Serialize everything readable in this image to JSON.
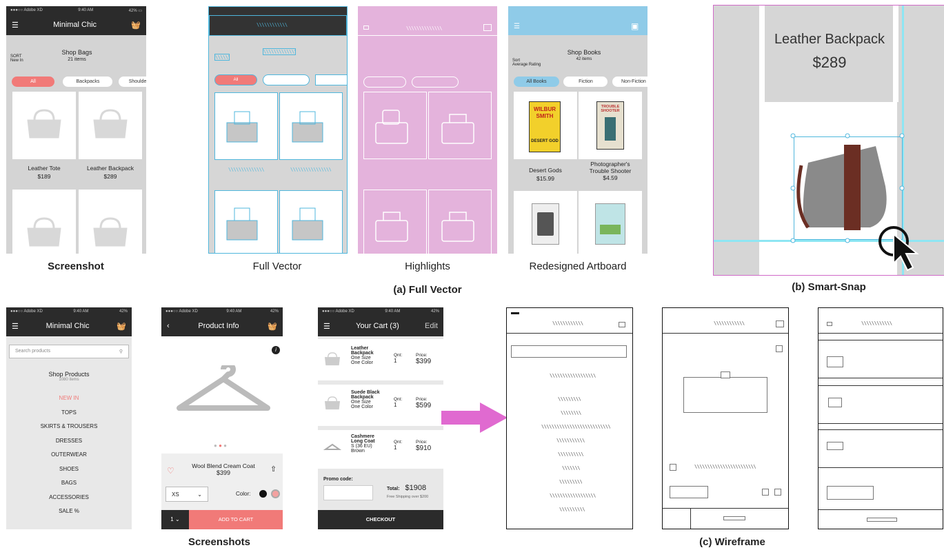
{
  "status": {
    "carrier": "●●●○○ Adobe XD",
    "time": "9:40 AM",
    "battery": "42%"
  },
  "screenshot1": {
    "title": "Minimal Chic",
    "sort_label": "SORT",
    "sort_value": "New In",
    "heading": "Shop Bags",
    "count": "21 items",
    "chips": [
      "All",
      "Backpacks",
      "Shoulder Bag"
    ],
    "products": [
      {
        "name": "Leather Tote",
        "price": "$189"
      },
      {
        "name": "Leather Backpack",
        "price": "$289"
      }
    ]
  },
  "vector_hatch": "\\\\\\\\\\\\\\\\\\\\\\\\",
  "redesign": {
    "sort_label": "Sort",
    "sort_value": "Average Rating",
    "heading": "Shop Books",
    "count": "42 items",
    "chips": [
      "All Books",
      "Fiction",
      "Non-Fiction"
    ],
    "products": [
      {
        "name": "Desert Gods",
        "price": "$15.99",
        "cover_title": "WILBUR SMITH",
        "cover_sub": "DESERT GOD"
      },
      {
        "name": "Photographer's Trouble Shooter",
        "price": "$4.59",
        "cover_title": "TROUBLE SHOOTER"
      }
    ]
  },
  "captions": {
    "screenshot": "Screenshot",
    "full_vector": "Full Vector",
    "highlights": "Highlights",
    "redesigned": "Redesigned Artboard",
    "fig_a": "(a) Full Vector",
    "fig_b": "(b) Smart-Snap",
    "screenshots": "Screenshots",
    "fig_c": "(c) Wireframe"
  },
  "smartsnap": {
    "title": "Leather Backpack",
    "price": "$289"
  },
  "menu_screen": {
    "title": "Minimal Chic",
    "search_placeholder": "Search products",
    "heading": "Shop Products",
    "count": "1080 items",
    "items": [
      "NEW IN",
      "TOPS",
      "SKIRTS & TROUSERS",
      "DRESSES",
      "OUTERWEAR",
      "SHOES",
      "BAGS",
      "ACCESSORIES",
      "SALE %"
    ]
  },
  "product_screen": {
    "title": "Product Info",
    "name": "Wool Blend Cream Coat",
    "price": "$399",
    "size": "XS",
    "color_label": "Color:",
    "qty": "1",
    "add_to_cart": "ADD TO CART"
  },
  "cart_screen": {
    "title": "Your Cart (3)",
    "edit": "Edit",
    "qnt_label": "Qnt:",
    "price_label": "Price:",
    "items": [
      {
        "name": "Leather Backpack",
        "size": "One Size",
        "color": "One Color",
        "qty": "1",
        "price": "$399"
      },
      {
        "name": "Suede Black Backpack",
        "size": "One Size",
        "color": "One Color",
        "qty": "1",
        "price": "$599"
      },
      {
        "name": "Cashmere Long Coat",
        "size": "S (36 EU)",
        "color": "Brown",
        "qty": "1",
        "price": "$910"
      }
    ],
    "promo_label": "Promo code:",
    "total_label": "Total:",
    "total": "$1908",
    "shipping": "Free Shipping over $200",
    "checkout": "CHECKOUT"
  },
  "colors": {
    "accent": "#f17a78",
    "nav": "#2b2b2b",
    "vector_blue": "#4fb7dd",
    "highlight_pink": "#e4b3dc",
    "redesign_blue": "#8fcbe8",
    "snap_cyan": "#8ee6f3",
    "arrow_magenta": "#e06ad0"
  }
}
